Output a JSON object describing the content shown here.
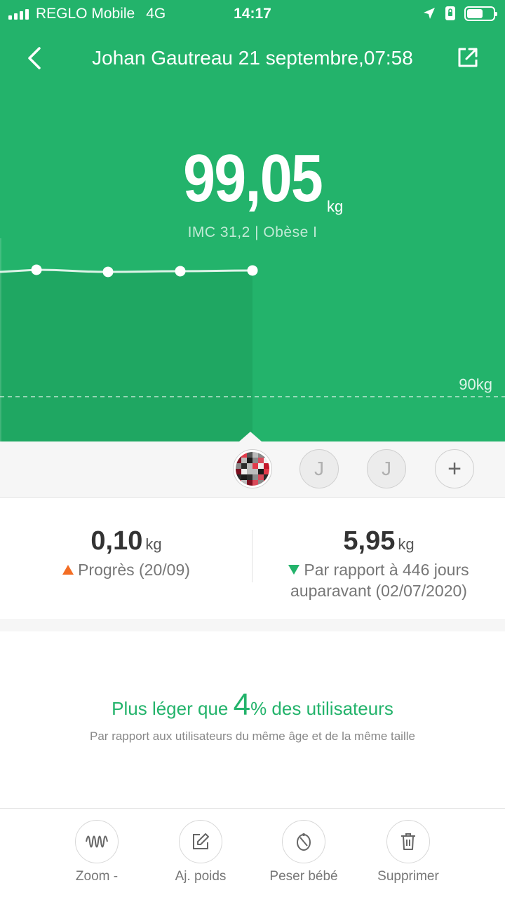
{
  "status_bar": {
    "carrier": "REGLO Mobile",
    "network": "4G",
    "time": "14:17"
  },
  "header": {
    "title": "Johan Gautreau 21 septembre,07:58",
    "icons": [
      "back-arrow-icon",
      "share-icon"
    ]
  },
  "weight": {
    "value": "99,05",
    "unit": "kg",
    "imc_text": "IMC 31,2 | Obèse I"
  },
  "chart_data": {
    "type": "line",
    "values": [
      99.1,
      98.95,
      99.0,
      99.05
    ],
    "reference_line": {
      "value": 90,
      "label": "90kg"
    },
    "grid": false,
    "colors": {
      "line": "#ffffff",
      "area": "#1fa560"
    }
  },
  "users": {
    "initials": [
      "J",
      "J"
    ],
    "add_symbol": "+"
  },
  "stats": {
    "left": {
      "value": "0,10",
      "unit": "kg",
      "desc": "Progrès (20/09)",
      "trend": "up"
    },
    "right": {
      "value": "5,95",
      "unit": "kg",
      "desc": "Par rapport à 446 jours auparavant (02/07/2020)",
      "trend": "down"
    }
  },
  "comparison": {
    "prefix": "Plus léger que ",
    "percent": "4",
    "suffix": "% des utilisateurs",
    "subtitle": "Par rapport aux utilisateurs du même âge et de la même taille"
  },
  "toolbar": {
    "zoom_label": "Zoom -",
    "adjust_label": "Aj. poids",
    "baby_label": "Peser bébé",
    "delete_label": "Supprimer"
  },
  "colors": {
    "accent": "#23b36b",
    "up": "#f36d24",
    "down": "#23b36b"
  }
}
